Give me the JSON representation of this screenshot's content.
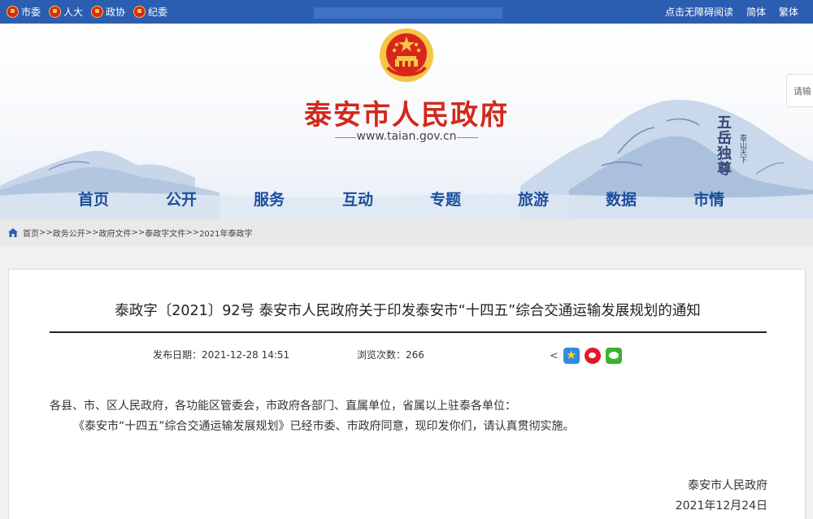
{
  "topbar": {
    "links": [
      {
        "label": "市委",
        "icon": "party-emblem-icon"
      },
      {
        "label": "人大",
        "icon": "national-emblem-icon"
      },
      {
        "label": "政协",
        "icon": "cppcc-emblem-icon"
      },
      {
        "label": "纪委",
        "icon": "party-emblem-icon"
      }
    ],
    "accessibility_label": "点击无障碍阅读",
    "simplified_label": "简体",
    "traditional_label": "繁体",
    "color": "#2b5db0"
  },
  "banner": {
    "title": "泰安市人民政府",
    "url": "www.taian.gov.cn",
    "calligraphy": "五岳独尊",
    "calligraphy_small": "泰山天下",
    "side_search_label": "请输"
  },
  "nav": {
    "items": [
      "首页",
      "公开",
      "服务",
      "互动",
      "专题",
      "旅游",
      "数据",
      "市情"
    ]
  },
  "breadcrumb": {
    "items": [
      "首页",
      "政务公开",
      "政府文件",
      "泰政字文件",
      "2021年泰政字"
    ],
    "separator": ">>"
  },
  "article": {
    "title": "泰政字〔2021〕92号 泰安市人民政府关于印发泰安市“十四五”综合交通运输发展规划的通知",
    "publish_label": "发布日期：",
    "publish_value": "2021-12-28 14:51",
    "views_label": "浏览次数：",
    "views_value": "266",
    "share_icons": [
      "share-icon",
      "qzone-icon",
      "weibo-icon",
      "wechat-icon"
    ],
    "recipients": "各县、市、区人民政府，各功能区管委会，市政府各部门、直属单位，省属以上驻泰各单位：",
    "body": "《泰安市“十四五”综合交通运输发展规划》已经市委、市政府同意，现印发你们，请认真贯彻实施。",
    "signature": "泰安市人民政府",
    "date": "2021年12月24日"
  },
  "colors": {
    "title_red": "#d3281d",
    "nav_blue": "#1a4f9c"
  }
}
